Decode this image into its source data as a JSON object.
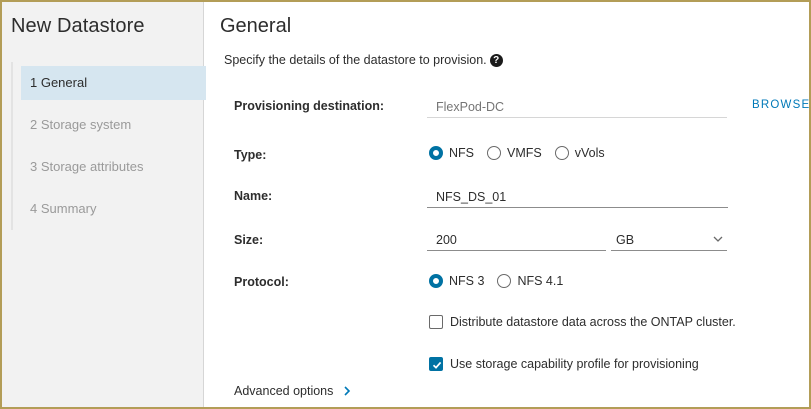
{
  "wizard": {
    "title": "New Datastore",
    "steps": [
      {
        "label": "1 General"
      },
      {
        "label": "2 Storage system"
      },
      {
        "label": "3 Storage attributes"
      },
      {
        "label": "4 Summary"
      }
    ],
    "active_step": 0
  },
  "page": {
    "title": "General",
    "intro": "Specify the details of the datastore to provision.",
    "help_icon": "?"
  },
  "form": {
    "provisioning_destination": {
      "label": "Provisioning destination:",
      "placeholder": "FlexPod-DC",
      "browse_label": "BROWSE"
    },
    "type": {
      "label": "Type:",
      "options": [
        {
          "label": "NFS",
          "checked": true
        },
        {
          "label": "VMFS",
          "checked": false
        },
        {
          "label": "vVols",
          "checked": false
        }
      ]
    },
    "name": {
      "label": "Name:",
      "value": "NFS_DS_01"
    },
    "size": {
      "label": "Size:",
      "value": "200",
      "unit": "GB"
    },
    "protocol": {
      "label": "Protocol:",
      "options": [
        {
          "label": "NFS 3",
          "checked": true
        },
        {
          "label": "NFS 4.1",
          "checked": false
        }
      ]
    },
    "distribute": {
      "label": "Distribute datastore data across the ONTAP cluster.",
      "checked": false
    },
    "capability_profile": {
      "label": "Use storage capability profile for provisioning",
      "checked": true
    },
    "advanced_options": {
      "label": "Advanced options"
    }
  },
  "colors": {
    "accent": "#0072a3",
    "link": "#0079b8",
    "active_step_bg": "#d6e6f0",
    "frame_border": "#b39d57"
  }
}
